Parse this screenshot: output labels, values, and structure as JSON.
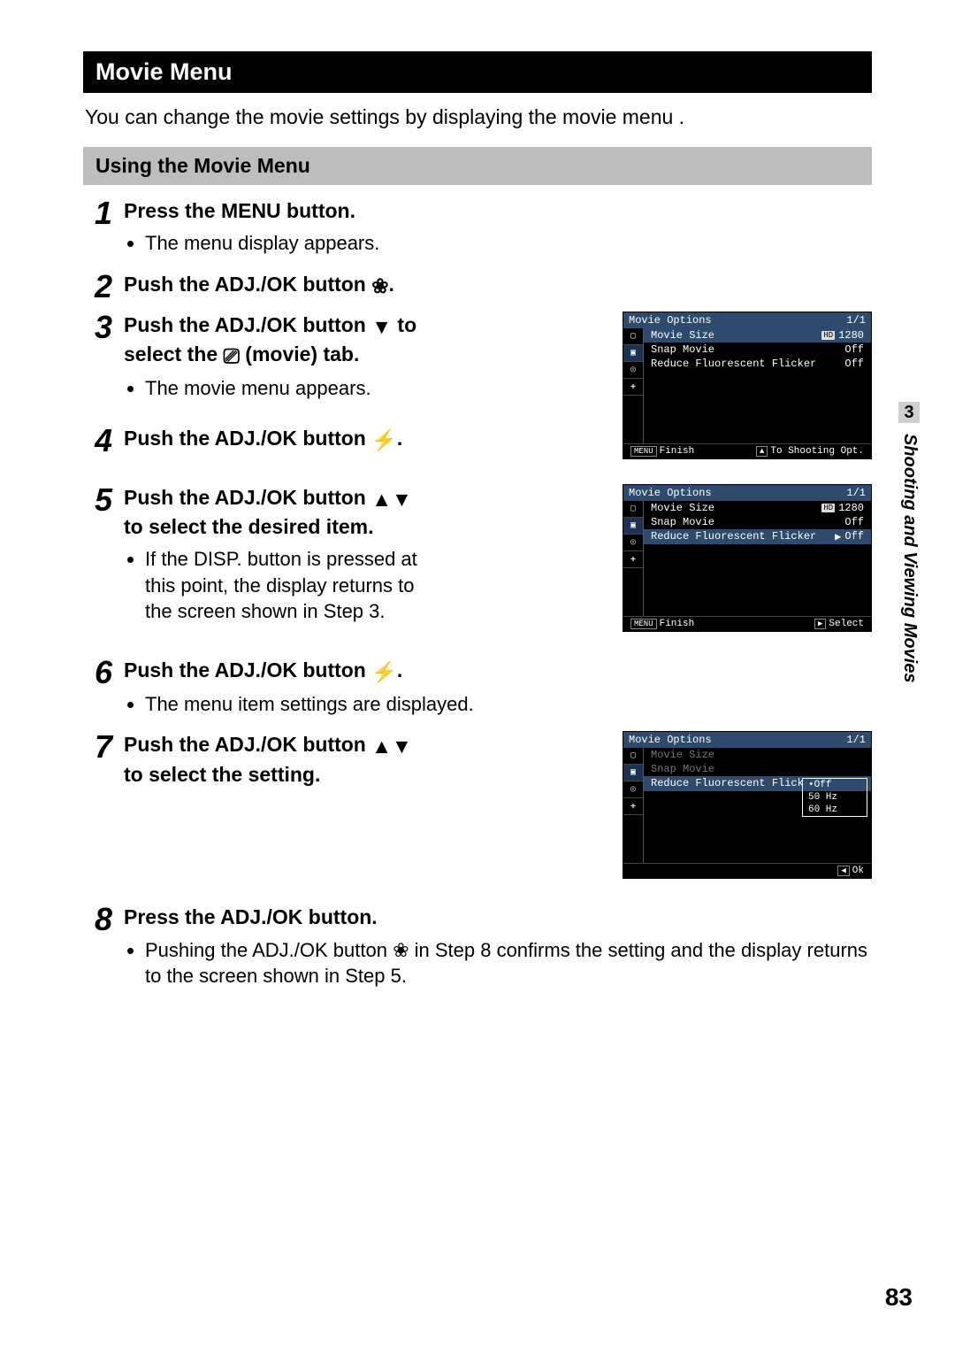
{
  "title": "Movie Menu",
  "intro": "You can change the movie settings by displaying the movie menu .",
  "subheading": "Using the  Movie Menu",
  "steps": {
    "s1": {
      "num": "1",
      "heading": "Press the MENU button.",
      "bullet1": "The menu display appears."
    },
    "s2": {
      "num": "2",
      "heading_prefix": "Push the ADJ./OK button ",
      "heading_suffix": "."
    },
    "s3": {
      "num": "3",
      "heading_prefix": "Push the ADJ./OK button ",
      "heading_mid": " to select the ",
      "heading_suffix": " (movie) tab.",
      "bullet1": "The movie menu appears."
    },
    "s4": {
      "num": "4",
      "heading_prefix": "Push the ADJ./OK button ",
      "heading_suffix": "."
    },
    "s5": {
      "num": "5",
      "heading_prefix": "Push the ADJ./OK button ",
      "heading_suffix": " to select the desired item.",
      "bullet1": "If the DISP. button is pressed at this point, the display returns to the screen shown in Step 3."
    },
    "s6": {
      "num": "6",
      "heading_prefix": "Push the ADJ./OK button ",
      "heading_suffix": ".",
      "bullet1": "The menu item settings are displayed."
    },
    "s7": {
      "num": "7",
      "heading_prefix": "Push the ADJ./OK button ",
      "heading_suffix": " to select the setting."
    },
    "s8": {
      "num": "8",
      "heading": "Press the ADJ./OK button.",
      "bullet_prefix": "Pushing the ADJ./OK button ",
      "bullet_suffix": " in Step 8 confirms the setting and the display returns to the screen shown in Step 5."
    }
  },
  "glyphs": {
    "macro": "❀",
    "down_tri": "▼",
    "up_tri": "▲",
    "updown": "▲▼",
    "flash": "⚡",
    "movie_tab": "⎚",
    "left_tri": "◀",
    "right_tri": "▶"
  },
  "screens": {
    "common": {
      "title": "Movie Options",
      "page": "1/1",
      "items": [
        "Movie Size",
        "Snap Movie",
        "Reduce Fluorescent Flicker"
      ],
      "values": {
        "hd": "HD",
        "size": "1280",
        "off": "Off"
      },
      "footer": {
        "menu": "MENU",
        "finish": "Finish",
        "shootopt_hint": "To Shooting Opt.",
        "select": "Select",
        "ok": "Ok"
      }
    },
    "dropdown": {
      "opt1": "Off",
      "opt2": "50 Hz",
      "opt3": "60 Hz"
    }
  },
  "side": {
    "tabnum": "3",
    "label": "Shooting and Viewing Movies"
  },
  "page_number": "83"
}
